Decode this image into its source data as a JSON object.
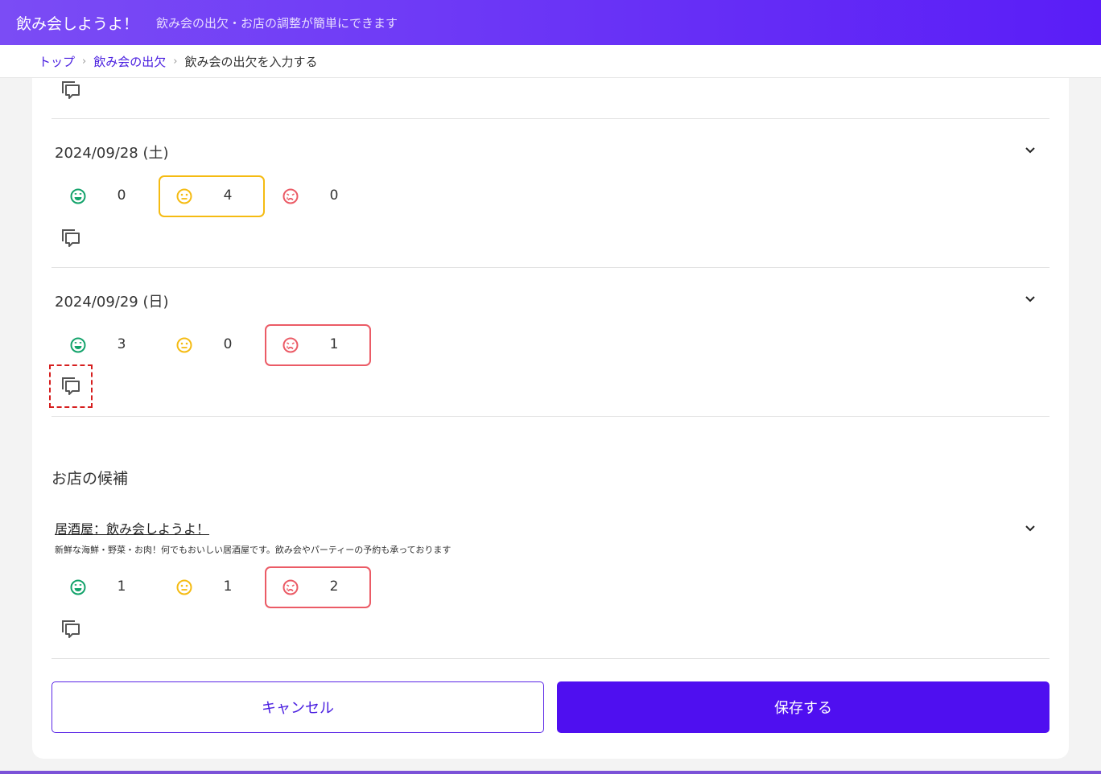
{
  "header": {
    "app_title": "飲み会しようよ！",
    "app_subtitle": "飲み会の出欠・お店の調整が簡単にできます"
  },
  "breadcrumb": {
    "items": [
      "トップ",
      "飲み会の出欠"
    ],
    "current": "飲み会の出欠を入力する"
  },
  "dates": [
    {
      "label": "2024/09/28 (土)",
      "ok": "0",
      "maybe": "4",
      "no": "0",
      "selected": "maybe"
    },
    {
      "label": "2024/09/29 (日)",
      "ok": "3",
      "maybe": "0",
      "no": "1",
      "selected": "no"
    }
  ],
  "shops": {
    "section_title": "お店の候補",
    "items": [
      {
        "name": "居酒屋：飲み会しようよ！",
        "description": "新鮮な海鮮・野菜・お肉！何でもおいしい居酒屋です。飲み会やパーティーの予約も承っております",
        "ok": "1",
        "maybe": "1",
        "no": "2",
        "selected": "no"
      }
    ]
  },
  "actions": {
    "cancel_label": "キャンセル",
    "save_label": "保存する"
  },
  "colors": {
    "header_start": "#7b4cf5",
    "header_end": "#5a1df7",
    "primary": "#4f0ff0",
    "ok": "#13a36b",
    "maybe": "#f5bb12",
    "no": "#eb5b66",
    "focus_outline": "#d61f1f"
  },
  "icons": {
    "comment": "comment-icon",
    "chevron": "chevron-down-icon",
    "ok": "smile-face-icon",
    "maybe": "neutral-face-icon",
    "no": "sad-face-icon"
  }
}
